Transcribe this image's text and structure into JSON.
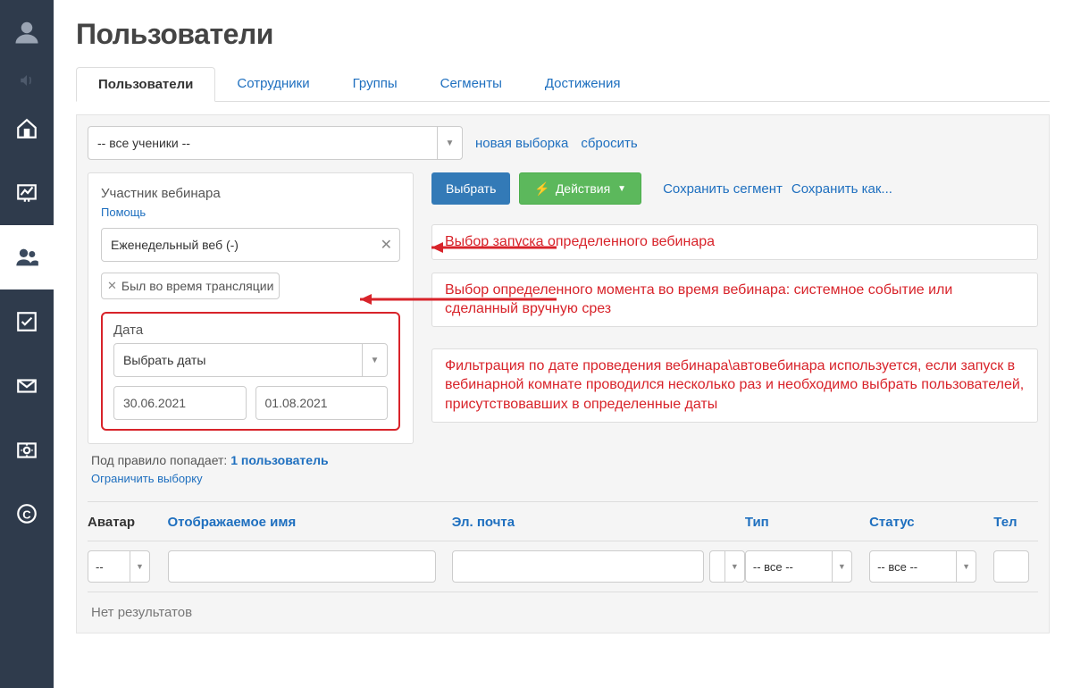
{
  "page": {
    "title": "Пользователи"
  },
  "tabs": [
    {
      "label": "Пользователи",
      "active": true
    },
    {
      "label": "Сотрудники"
    },
    {
      "label": "Группы"
    },
    {
      "label": "Сегменты"
    },
    {
      "label": "Достижения"
    }
  ],
  "topFilter": {
    "select_value": "-- все ученики --",
    "new_selection": "новая выборка",
    "reset": "сбросить"
  },
  "filter": {
    "title": "Участник вебинара",
    "help": "Помощь",
    "webinar_value": "Еженедельный веб (-)",
    "tag_value": "Был во время трансляции",
    "date_label": "Дата",
    "date_select": "Выбрать даты",
    "date_from": "30.06.2021",
    "date_to": "01.08.2021"
  },
  "rule": {
    "prefix": "Под правило попадает: ",
    "count": "1 пользователь",
    "limit": "Ограничить выборку"
  },
  "actions": {
    "choose": "Выбрать",
    "actions": "Действия",
    "save_segment": "Сохранить сегмент",
    "save_as": "Сохранить как..."
  },
  "annotations": {
    "a1": "Выбор запуска определенного вебинара",
    "a2": "Выбор определенного момента во время вебинара: системное событие или сделанный вручную срез",
    "a3": "Фильтрация по дате проведения вебинара\\автовебинара используется, если запуск в вебинарной комнате проводился несколько раз и необходимо выбрать пользователей, присутствовавших в определенные даты"
  },
  "table": {
    "headers": {
      "avatar": "Аватар",
      "name": "Отображаемое имя",
      "email": "Эл. почта",
      "type": "Тип",
      "status": "Статус",
      "tel": "Тел"
    },
    "filters": {
      "avatar": "--",
      "type": "-- все --",
      "status": "-- все --"
    },
    "no_results": "Нет результатов"
  },
  "sidebar_icons": [
    "user",
    "volume",
    "home",
    "chart",
    "users",
    "check",
    "mail",
    "gear",
    "chat"
  ]
}
